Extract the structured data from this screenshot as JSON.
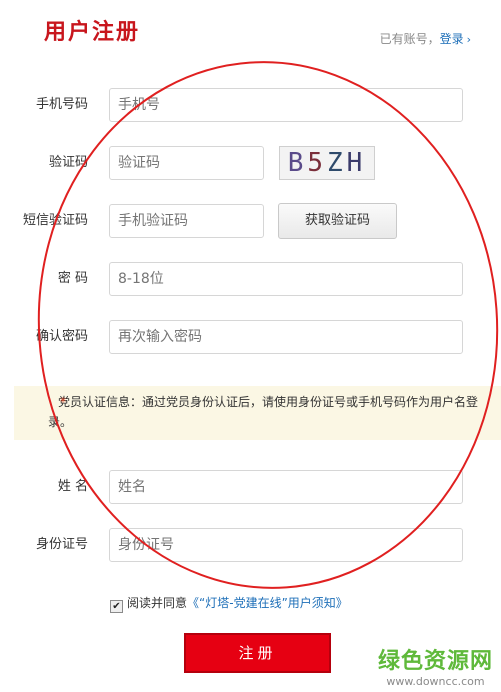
{
  "header": {
    "title": "用户注册",
    "has_account_text": "已有账号，",
    "login_link": "登录",
    "chevron": "›"
  },
  "form": {
    "phone": {
      "label": "手机号码",
      "placeholder": "手机号"
    },
    "captcha": {
      "label": "验证码",
      "placeholder": "验证码",
      "image_text": [
        "B",
        "5",
        "Z",
        "H"
      ]
    },
    "sms": {
      "label": "短信验证码",
      "placeholder": "手机验证码",
      "button": "获取验证码"
    },
    "password": {
      "label": "密 码",
      "placeholder": "8-18位"
    },
    "confirm": {
      "label": "确认密码",
      "placeholder": "再次输入密码"
    }
  },
  "notice": {
    "star": "*",
    "text": "党员认证信息：通过党员身份认证后，请使用身份证号或手机号码作为用户名登录。"
  },
  "member": {
    "name": {
      "label": "姓 名",
      "placeholder": "姓名"
    },
    "id_number": {
      "label": "身份证号",
      "placeholder": "身份证号"
    }
  },
  "agreement": {
    "checked": true,
    "check_mark": "✔",
    "prefix": "阅读并同意",
    "link": "《“灯塔-党建在线”用户须知》"
  },
  "submit": {
    "label": "注册"
  },
  "watermark": {
    "main": "绿色资源网",
    "url": "www.downcc.com"
  },
  "colors": {
    "brand_red": "#c8161d",
    "button_red": "#e60012",
    "link_blue": "#1e6fb8",
    "annotation_red": "#e02020"
  }
}
